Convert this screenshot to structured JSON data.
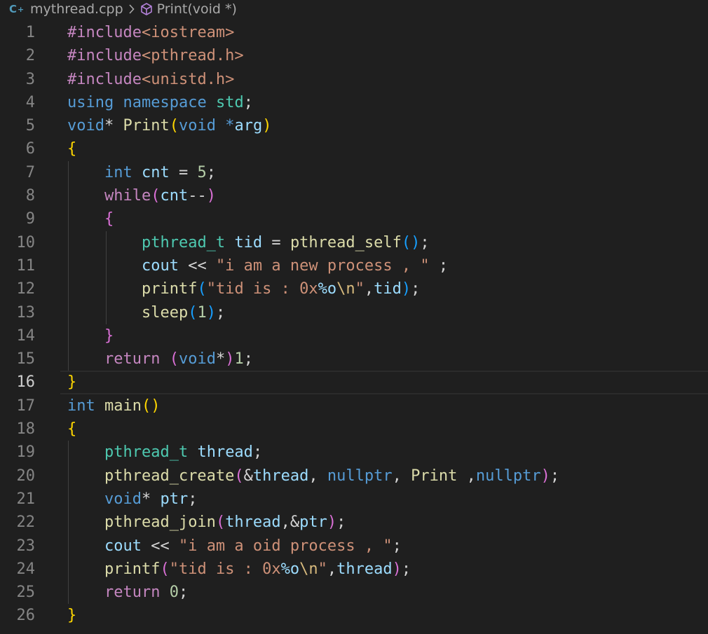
{
  "breadcrumb": {
    "file_icon": "cpp-file-icon",
    "file_icon_glyph": "C",
    "file_icon_plus": "+",
    "file_name": "mythread.cpp",
    "separator_icon": "chevron-right-icon",
    "symbol_icon": "method-cube-icon",
    "symbol_name": "Print(void *)"
  },
  "editor": {
    "current_line": 16,
    "lines": [
      {
        "n": "1",
        "tokens": [
          [
            "tk-ctrl",
            "#include"
          ],
          [
            "tk-inc",
            "<iostream>"
          ]
        ]
      },
      {
        "n": "2",
        "tokens": [
          [
            "tk-ctrl",
            "#include"
          ],
          [
            "tk-inc",
            "<pthread.h>"
          ]
        ]
      },
      {
        "n": "3",
        "tokens": [
          [
            "tk-ctrl",
            "#include"
          ],
          [
            "tk-inc",
            "<unistd.h>"
          ]
        ]
      },
      {
        "n": "4",
        "tokens": [
          [
            "tk-kw",
            "using"
          ],
          [
            "tk-p",
            " "
          ],
          [
            "tk-kw",
            "namespace"
          ],
          [
            "tk-p",
            " "
          ],
          [
            "tk-type",
            "std"
          ],
          [
            "tk-p",
            ";"
          ]
        ]
      },
      {
        "n": "5",
        "tokens": [
          [
            "tk-kw",
            "void"
          ],
          [
            "tk-p",
            "* "
          ],
          [
            "tk-fn",
            "Print"
          ],
          [
            "tk-b1",
            "("
          ],
          [
            "tk-kw",
            "void"
          ],
          [
            "tk-p",
            " "
          ],
          [
            "tk-kw",
            "*"
          ],
          [
            "tk-var",
            "arg"
          ],
          [
            "tk-b1",
            ")"
          ]
        ]
      },
      {
        "n": "6",
        "tokens": [
          [
            "tk-b1",
            "{"
          ]
        ]
      },
      {
        "n": "7",
        "tokens": [
          [
            "tk-p",
            "    "
          ],
          [
            "tk-kw",
            "int"
          ],
          [
            "tk-p",
            " "
          ],
          [
            "tk-var",
            "cnt"
          ],
          [
            "tk-p",
            " = "
          ],
          [
            "tk-num",
            "5"
          ],
          [
            "tk-p",
            ";"
          ]
        ]
      },
      {
        "n": "8",
        "tokens": [
          [
            "tk-p",
            "    "
          ],
          [
            "tk-ctrl",
            "while"
          ],
          [
            "tk-b2",
            "("
          ],
          [
            "tk-var",
            "cnt"
          ],
          [
            "tk-p",
            "--"
          ],
          [
            "tk-b2",
            ")"
          ]
        ]
      },
      {
        "n": "9",
        "tokens": [
          [
            "tk-p",
            "    "
          ],
          [
            "tk-b2",
            "{"
          ]
        ]
      },
      {
        "n": "10",
        "tokens": [
          [
            "tk-p",
            "        "
          ],
          [
            "tk-type",
            "pthread_t"
          ],
          [
            "tk-p",
            " "
          ],
          [
            "tk-var",
            "tid"
          ],
          [
            "tk-p",
            " = "
          ],
          [
            "tk-fn",
            "pthread_self"
          ],
          [
            "tk-b3",
            "()"
          ],
          [
            "tk-p",
            ";"
          ]
        ]
      },
      {
        "n": "11",
        "tokens": [
          [
            "tk-p",
            "        "
          ],
          [
            "tk-var",
            "cout"
          ],
          [
            "tk-p",
            " << "
          ],
          [
            "tk-str",
            "\"i am a new process , \""
          ],
          [
            "tk-p",
            " ;"
          ]
        ]
      },
      {
        "n": "12",
        "tokens": [
          [
            "tk-p",
            "        "
          ],
          [
            "tk-fn",
            "printf"
          ],
          [
            "tk-b3",
            "("
          ],
          [
            "tk-str",
            "\"tid is : 0x"
          ],
          [
            "tk-fmt",
            "%o"
          ],
          [
            "tk-esc",
            "\\n"
          ],
          [
            "tk-str",
            "\""
          ],
          [
            "tk-p",
            ","
          ],
          [
            "tk-var",
            "tid"
          ],
          [
            "tk-b3",
            ")"
          ],
          [
            "tk-p",
            ";"
          ]
        ]
      },
      {
        "n": "13",
        "tokens": [
          [
            "tk-p",
            "        "
          ],
          [
            "tk-fn",
            "sleep"
          ],
          [
            "tk-b3",
            "("
          ],
          [
            "tk-num",
            "1"
          ],
          [
            "tk-b3",
            ")"
          ],
          [
            "tk-p",
            ";"
          ]
        ]
      },
      {
        "n": "14",
        "tokens": [
          [
            "tk-p",
            "    "
          ],
          [
            "tk-b2",
            "}"
          ]
        ]
      },
      {
        "n": "15",
        "tokens": [
          [
            "tk-p",
            "    "
          ],
          [
            "tk-ctrl",
            "return"
          ],
          [
            "tk-p",
            " "
          ],
          [
            "tk-b2",
            "("
          ],
          [
            "tk-kw",
            "void"
          ],
          [
            "tk-p",
            "*"
          ],
          [
            "tk-b2",
            ")"
          ],
          [
            "tk-num",
            "1"
          ],
          [
            "tk-p",
            ";"
          ]
        ]
      },
      {
        "n": "16",
        "tokens": [
          [
            "tk-b1",
            "}"
          ]
        ]
      },
      {
        "n": "17",
        "tokens": [
          [
            "tk-kw",
            "int"
          ],
          [
            "tk-p",
            " "
          ],
          [
            "tk-fn",
            "main"
          ],
          [
            "tk-b1",
            "()"
          ]
        ]
      },
      {
        "n": "18",
        "tokens": [
          [
            "tk-b1",
            "{"
          ]
        ]
      },
      {
        "n": "19",
        "tokens": [
          [
            "tk-p",
            "    "
          ],
          [
            "tk-type",
            "pthread_t"
          ],
          [
            "tk-p",
            " "
          ],
          [
            "tk-var",
            "thread"
          ],
          [
            "tk-p",
            ";"
          ]
        ]
      },
      {
        "n": "20",
        "tokens": [
          [
            "tk-p",
            "    "
          ],
          [
            "tk-fn",
            "pthread_create"
          ],
          [
            "tk-b2",
            "("
          ],
          [
            "tk-p",
            "&"
          ],
          [
            "tk-var",
            "thread"
          ],
          [
            "tk-p",
            ", "
          ],
          [
            "tk-kw",
            "nullptr"
          ],
          [
            "tk-p",
            ", "
          ],
          [
            "tk-fn",
            "Print"
          ],
          [
            "tk-p",
            " ,"
          ],
          [
            "tk-kw",
            "nullptr"
          ],
          [
            "tk-b2",
            ")"
          ],
          [
            "tk-p",
            ";"
          ]
        ]
      },
      {
        "n": "21",
        "tokens": [
          [
            "tk-p",
            "    "
          ],
          [
            "tk-kw",
            "void"
          ],
          [
            "tk-p",
            "* "
          ],
          [
            "tk-var",
            "ptr"
          ],
          [
            "tk-p",
            ";"
          ]
        ]
      },
      {
        "n": "22",
        "tokens": [
          [
            "tk-p",
            "    "
          ],
          [
            "tk-fn",
            "pthread_join"
          ],
          [
            "tk-b2",
            "("
          ],
          [
            "tk-var",
            "thread"
          ],
          [
            "tk-p",
            ",&"
          ],
          [
            "tk-var",
            "ptr"
          ],
          [
            "tk-b2",
            ")"
          ],
          [
            "tk-p",
            ";"
          ]
        ]
      },
      {
        "n": "23",
        "tokens": [
          [
            "tk-p",
            "    "
          ],
          [
            "tk-var",
            "cout"
          ],
          [
            "tk-p",
            " << "
          ],
          [
            "tk-str",
            "\"i am a oid process , \""
          ],
          [
            "tk-p",
            ";"
          ]
        ]
      },
      {
        "n": "24",
        "tokens": [
          [
            "tk-p",
            "    "
          ],
          [
            "tk-fn",
            "printf"
          ],
          [
            "tk-b2",
            "("
          ],
          [
            "tk-str",
            "\"tid is : 0x"
          ],
          [
            "tk-fmt",
            "%o"
          ],
          [
            "tk-esc",
            "\\n"
          ],
          [
            "tk-str",
            "\""
          ],
          [
            "tk-p",
            ","
          ],
          [
            "tk-var",
            "thread"
          ],
          [
            "tk-b2",
            ")"
          ],
          [
            "tk-p",
            ";"
          ]
        ]
      },
      {
        "n": "25",
        "tokens": [
          [
            "tk-p",
            "    "
          ],
          [
            "tk-ctrl",
            "return"
          ],
          [
            "tk-p",
            " "
          ],
          [
            "tk-num",
            "0"
          ],
          [
            "tk-p",
            ";"
          ]
        ]
      },
      {
        "n": "26",
        "tokens": [
          [
            "tk-b1",
            "}"
          ]
        ]
      }
    ]
  }
}
